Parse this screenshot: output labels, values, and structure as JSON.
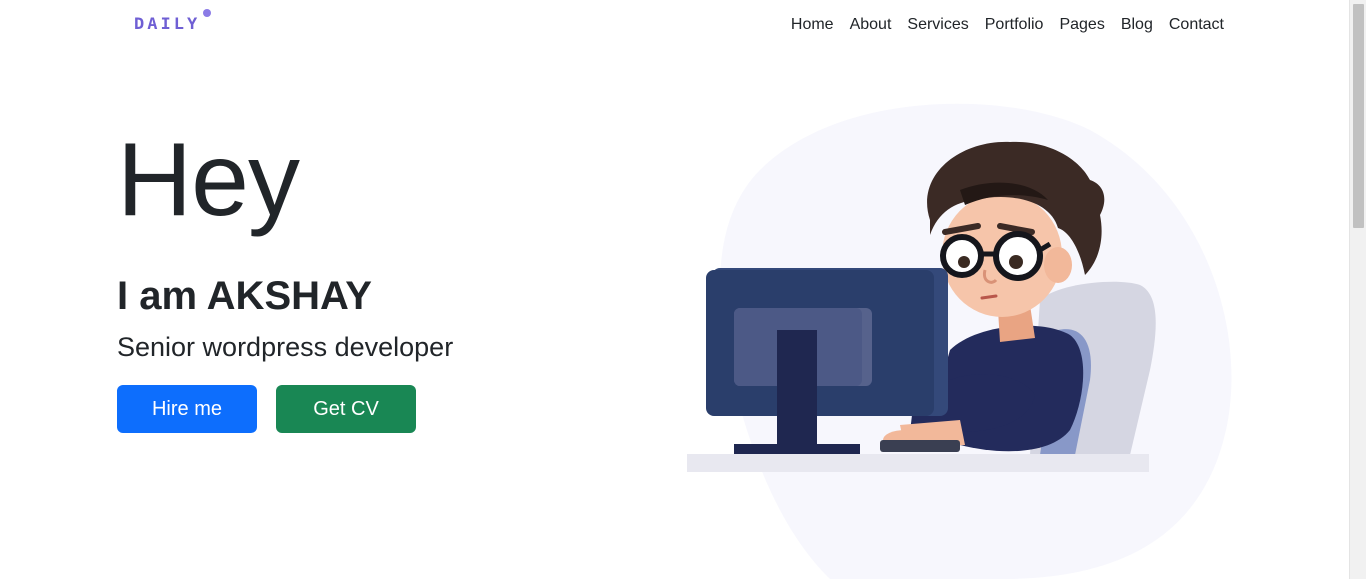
{
  "brand": {
    "logo_text": "DAILY",
    "logo_color": "#6f5fd4"
  },
  "nav": {
    "items": [
      {
        "label": "Home"
      },
      {
        "label": "About"
      },
      {
        "label": "Services"
      },
      {
        "label": "Portfolio"
      },
      {
        "label": "Pages"
      },
      {
        "label": "Blog"
      },
      {
        "label": "Contact"
      }
    ]
  },
  "hero": {
    "greeting": "Hey",
    "name_line": "I am AKSHAY",
    "role": "Senior wordpress developer",
    "hire_button": {
      "label": "Hire me",
      "color": "#0d6efd"
    },
    "cv_button": {
      "label": "Get CV",
      "color": "#198754"
    }
  },
  "illustration": {
    "icon": "developer-at-computer-illustration"
  }
}
